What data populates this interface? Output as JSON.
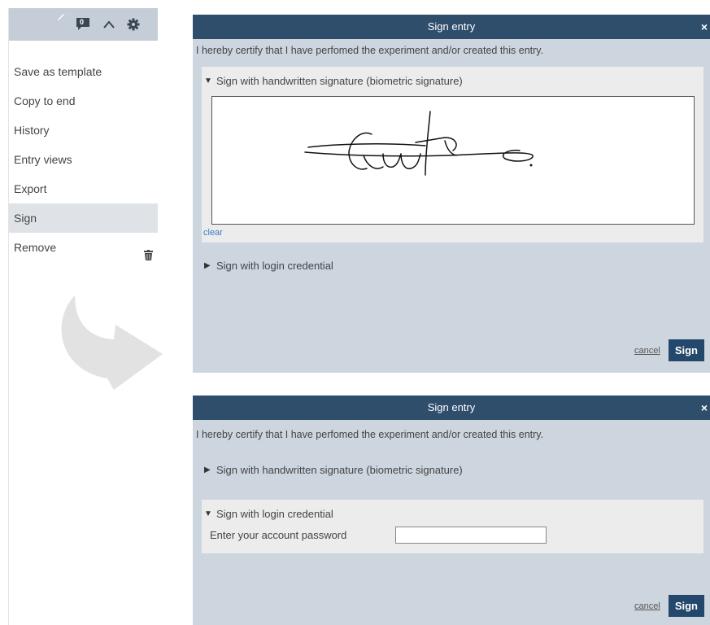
{
  "menu": {
    "items": [
      {
        "label": "Save as template"
      },
      {
        "label": "Copy to end"
      },
      {
        "label": "History"
      },
      {
        "label": "Entry views"
      },
      {
        "label": "Export"
      },
      {
        "label": "Sign"
      },
      {
        "label": "Remove"
      }
    ],
    "active_item": "Sign",
    "toolbar_icons": [
      "pencil-icon",
      "comment-icon",
      "chevron-up-icon",
      "gear-icon"
    ],
    "comment_badge": "0"
  },
  "dialog_top": {
    "title": "Sign entry",
    "close": "×",
    "certify_text": "I hereby certify that I have perfomed the experiment and/or created this entry.",
    "handwritten_label": "Sign with handwritten signature (biometric signature)",
    "handwritten_expanded": true,
    "clear_label": "clear",
    "login_label": "Sign with login credential",
    "login_expanded": false,
    "cancel_label": "cancel",
    "sign_label": "Sign"
  },
  "dialog_bottom": {
    "title": "Sign entry",
    "close": "×",
    "certify_text": "I hereby certify that I have perfomed the experiment and/or created this entry.",
    "handwritten_label": "Sign with handwritten signature (biometric signature)",
    "handwritten_expanded": false,
    "login_label": "Sign with login credential",
    "login_expanded": true,
    "password_label": "Enter your account password",
    "password_value": "",
    "cancel_label": "cancel",
    "sign_label": "Sign"
  },
  "colors": {
    "title_bar": "#2e4e6c",
    "dialog_bg": "#cdd5de",
    "sign_button": "#23486b",
    "link": "#3a7bc8"
  }
}
